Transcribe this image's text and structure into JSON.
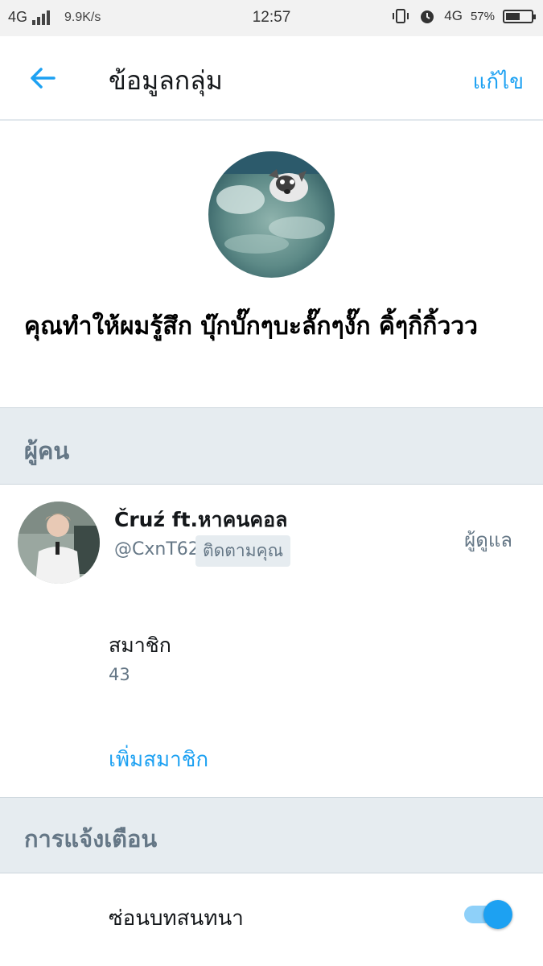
{
  "status_bar": {
    "network": "4G",
    "speed": "9.9K/s",
    "time": "12:57",
    "network_right": "4G",
    "battery": "57%",
    "battery_level": 0.57
  },
  "header": {
    "title": "ข้อมูลกลุ่ม",
    "edit_label": "แก้ไข"
  },
  "group": {
    "name": "คุณทำให้ผมรู้สึก บุ๊กบั๊กๆบะลั๊กๆงั๊ก คิ้ๆกิ่กิ้ววว"
  },
  "people_section": {
    "title": "ผู้คน",
    "member": {
      "name": "Čruź ft.หาคนคอล",
      "handle": "@CxnT62",
      "follows_you": "ติดตามคุณ",
      "role": "ผู้ดูแล"
    },
    "members_label": "สมาชิก",
    "members_count": "43",
    "add_member": "เพิ่มสมาชิก"
  },
  "notifications_section": {
    "title": "การแจ้งเตือน",
    "hide_conversation": "ซ่อนบทสนทนา",
    "hide_conversation_on": true
  },
  "colors": {
    "accent": "#1da1f2",
    "section_bg": "#e6ecf0",
    "muted_text": "#657786"
  }
}
